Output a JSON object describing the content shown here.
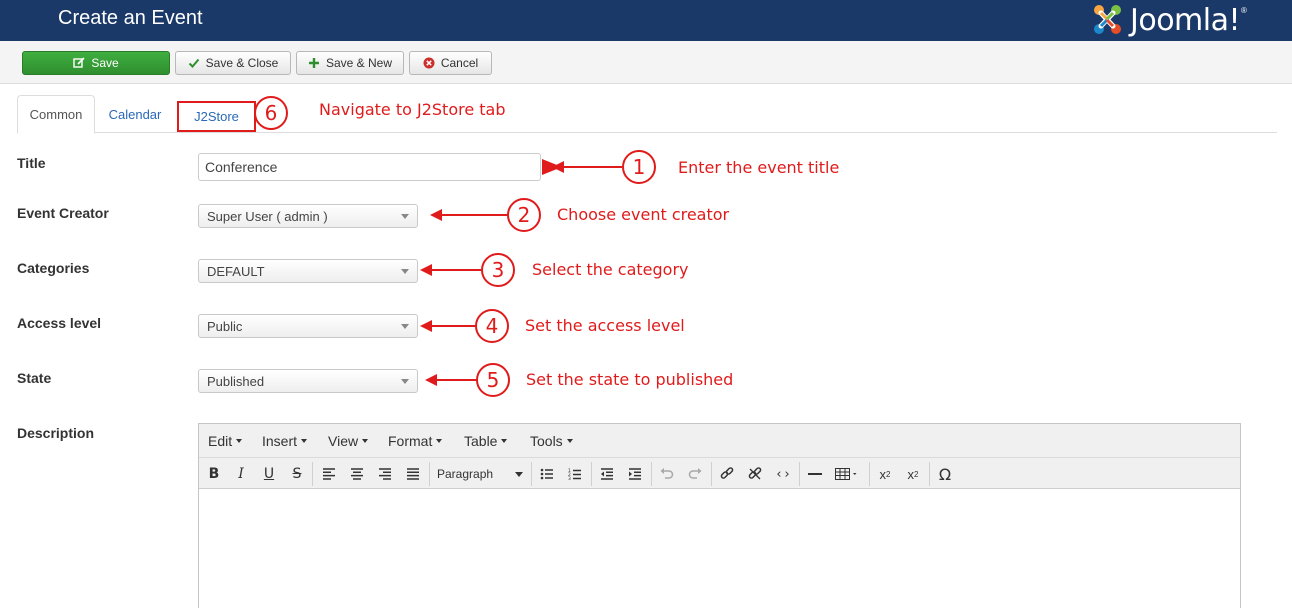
{
  "header": {
    "title": "Create an Event",
    "logo_text": "Joomla!",
    "logo_reg": "®"
  },
  "toolbar": {
    "save": "Save",
    "save_close": "Save & Close",
    "save_new": "Save & New",
    "cancel": "Cancel"
  },
  "tabs": [
    "Common",
    "Calendar",
    "J2Store"
  ],
  "form": {
    "title_label": "Title",
    "title_value": "Conference",
    "creator_label": "Event Creator",
    "creator_value": "Super User ( admin )",
    "categories_label": "Categories",
    "categories_value": "DEFAULT",
    "access_label": "Access level",
    "access_value": "Public",
    "state_label": "State",
    "state_value": "Published",
    "description_label": "Description"
  },
  "editor": {
    "menus": [
      "Edit",
      "Insert",
      "View",
      "Format",
      "Table",
      "Tools"
    ],
    "paragraph": "Paragraph"
  },
  "annotations": [
    {
      "num": "1",
      "text": "Enter the event title"
    },
    {
      "num": "2",
      "text": "Choose event creator"
    },
    {
      "num": "3",
      "text": "Select the category"
    },
    {
      "num": "4",
      "text": "Set the access level"
    },
    {
      "num": "5",
      "text": "Set the state to published"
    },
    {
      "num": "6",
      "text": "Navigate to J2Store tab"
    }
  ],
  "colors": {
    "header": "#1b3968",
    "save_button": "#2f8f2f",
    "annotation": "#e01b1b",
    "link": "#2a69b8"
  }
}
